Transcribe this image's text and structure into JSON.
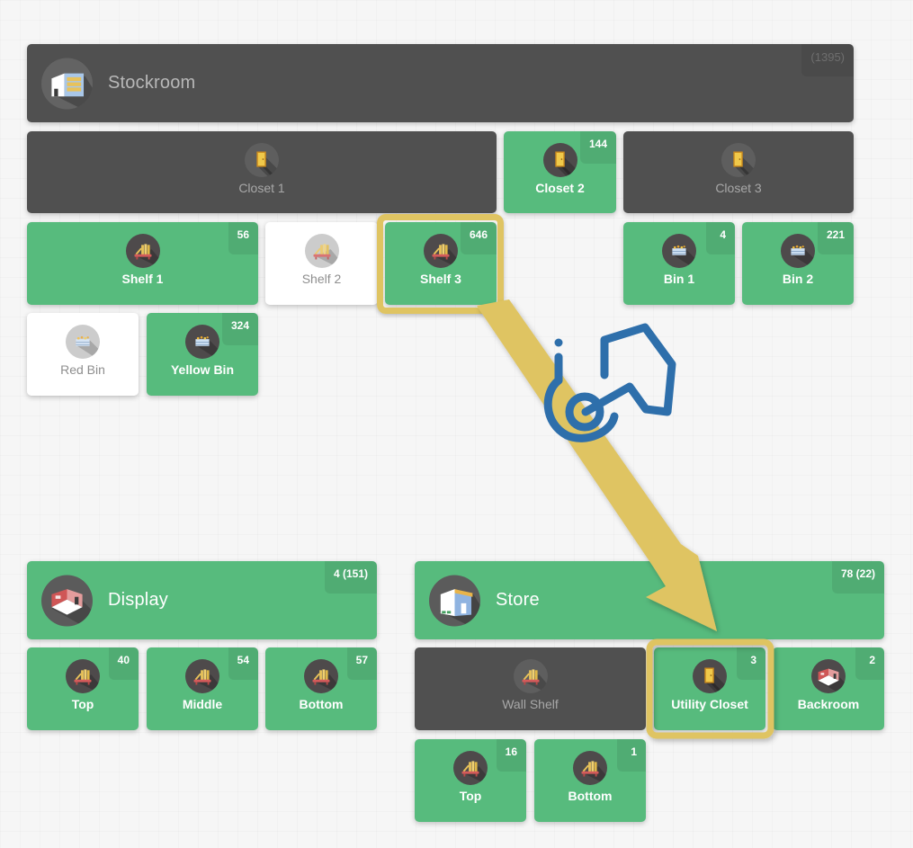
{
  "colors": {
    "green": "#57bb7d",
    "dark": "#505050",
    "highlight": "#dfc462",
    "cursor_blue": "#2e6fab"
  },
  "stockroom": {
    "label": "Stockroom",
    "icon": "warehouse-icon",
    "badge": "(1395)",
    "children": [
      {
        "label": "Closet 1",
        "icon": "door-icon",
        "badge": "",
        "state": "dark"
      },
      {
        "label": "Closet 2",
        "icon": "door-icon",
        "badge": "144",
        "state": "green"
      },
      {
        "label": "Closet 3",
        "icon": "door-icon",
        "badge": "",
        "state": "dark"
      },
      {
        "label": "Shelf 1",
        "icon": "shelf-icon",
        "badge": "56",
        "state": "green"
      },
      {
        "label": "Shelf 2",
        "icon": "shelf-icon",
        "badge": "",
        "state": "white"
      },
      {
        "label": "Shelf 3",
        "icon": "shelf-icon",
        "badge": "646",
        "state": "green",
        "highlighted": true
      },
      {
        "label": "Bin 1",
        "icon": "bin-icon",
        "badge": "4",
        "state": "green"
      },
      {
        "label": "Bin 2",
        "icon": "bin-icon",
        "badge": "221",
        "state": "green"
      },
      {
        "label": "Red Bin",
        "icon": "bin-icon",
        "badge": "",
        "state": "white"
      },
      {
        "label": "Yellow Bin",
        "icon": "bin-icon",
        "badge": "324",
        "state": "green"
      }
    ]
  },
  "display": {
    "label": "Display",
    "icon": "room-icon",
    "badge": "4 (151)",
    "children": [
      {
        "label": "Top",
        "icon": "shelf-icon",
        "badge": "40",
        "state": "green"
      },
      {
        "label": "Middle",
        "icon": "shelf-icon",
        "badge": "54",
        "state": "green"
      },
      {
        "label": "Bottom",
        "icon": "shelf-icon",
        "badge": "57",
        "state": "green"
      }
    ]
  },
  "store": {
    "label": "Store",
    "icon": "store-icon",
    "badge": "78 (22)",
    "children": [
      {
        "label": "Wall Shelf",
        "icon": "shelf-icon",
        "badge": "",
        "state": "dark"
      },
      {
        "label": "Utility Closet",
        "icon": "door-icon",
        "badge": "3",
        "state": "green",
        "highlighted": true
      },
      {
        "label": "Backroom",
        "icon": "room-icon",
        "badge": "2",
        "state": "green"
      },
      {
        "label": "Top",
        "icon": "shelf-icon",
        "badge": "16",
        "state": "green"
      },
      {
        "label": "Bottom",
        "icon": "shelf-icon",
        "badge": "1",
        "state": "green"
      }
    ]
  },
  "annotation": {
    "arrow": "move-arrow",
    "cursor": "drag-hand-cursor-icon",
    "from": "Shelf 3",
    "to": "Utility Closet"
  }
}
